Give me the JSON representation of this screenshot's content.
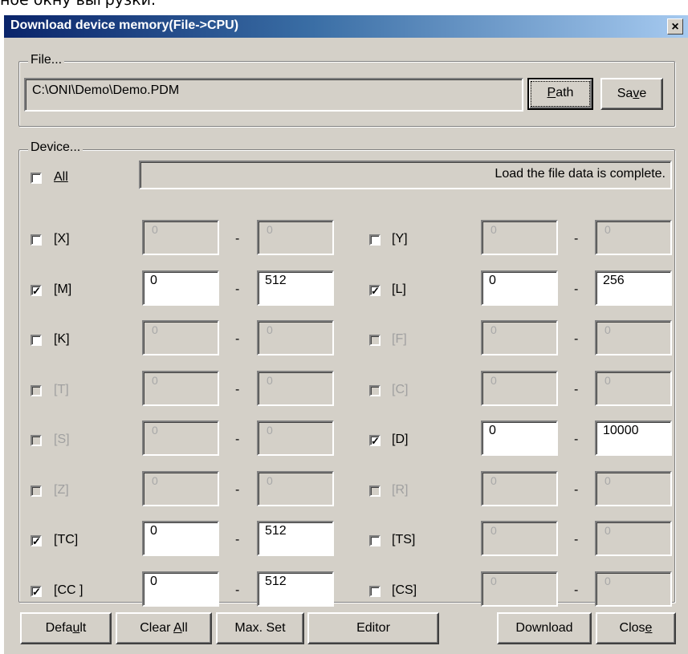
{
  "top_caption": "ное окну выгрузки.",
  "window": {
    "title": "Download device memory(File->CPU)",
    "close_glyph": "×"
  },
  "file_group": {
    "legend": "File...",
    "path_value": "C:\\ONI\\Demo\\Demo.PDM",
    "path_button": "Path",
    "save_button": "Save"
  },
  "device_group": {
    "legend": "Device...",
    "all_label": "All",
    "all_checked": false,
    "status_text": "Load the file data is complete."
  },
  "devices_left": [
    {
      "label": "[X]",
      "checked": false,
      "enabled": true,
      "from": "0",
      "to": "0",
      "fields_enabled": false
    },
    {
      "label": "[M]",
      "checked": true,
      "enabled": true,
      "from": "0",
      "to": "512",
      "fields_enabled": true
    },
    {
      "label": "[K]",
      "checked": false,
      "enabled": true,
      "from": "0",
      "to": "0",
      "fields_enabled": false
    },
    {
      "label": "[T]",
      "checked": false,
      "enabled": false,
      "from": "0",
      "to": "0",
      "fields_enabled": false
    },
    {
      "label": "[S]",
      "checked": false,
      "enabled": false,
      "from": "0",
      "to": "0",
      "fields_enabled": false
    },
    {
      "label": "[Z]",
      "checked": false,
      "enabled": false,
      "from": "0",
      "to": "0",
      "fields_enabled": false
    },
    {
      "label": "[TC]",
      "checked": true,
      "enabled": true,
      "from": "0",
      "to": "512",
      "fields_enabled": true
    },
    {
      "label": "[CC ]",
      "checked": true,
      "enabled": true,
      "from": "0",
      "to": "512",
      "fields_enabled": true
    }
  ],
  "devices_right": [
    {
      "label": "[Y]",
      "checked": false,
      "enabled": true,
      "from": "0",
      "to": "0",
      "fields_enabled": false
    },
    {
      "label": "[L]",
      "checked": true,
      "enabled": true,
      "from": "0",
      "to": "256",
      "fields_enabled": true
    },
    {
      "label": "[F]",
      "checked": false,
      "enabled": false,
      "from": "0",
      "to": "0",
      "fields_enabled": false
    },
    {
      "label": "[C]",
      "checked": false,
      "enabled": false,
      "from": "0",
      "to": "0",
      "fields_enabled": false
    },
    {
      "label": "[D]",
      "checked": true,
      "enabled": true,
      "from": "0",
      "to": "10000",
      "fields_enabled": true
    },
    {
      "label": "[R]",
      "checked": false,
      "enabled": false,
      "from": "0",
      "to": "0",
      "fields_enabled": false
    },
    {
      "label": "[TS]",
      "checked": false,
      "enabled": true,
      "from": "0",
      "to": "0",
      "fields_enabled": false
    },
    {
      "label": "[CS]",
      "checked": false,
      "enabled": true,
      "from": "0",
      "to": "0",
      "fields_enabled": false
    }
  ],
  "range_separator": "-",
  "buttons": {
    "default": "Default",
    "clear_all": "Clear All",
    "max_set": "Max. Set",
    "editor": "Editor",
    "download": "Download",
    "close": "Close"
  },
  "colors": {
    "dialog_bg": "#d4d0c8",
    "title_start": "#0a246a",
    "title_end": "#a6caf0",
    "disabled_text": "#a8a8a8"
  },
  "icons": {
    "check": "check-mark-icon",
    "close": "close-icon"
  }
}
